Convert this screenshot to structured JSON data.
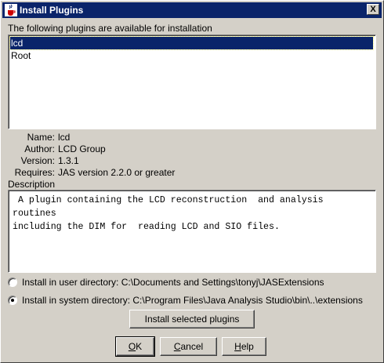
{
  "window": {
    "title": "Install Plugins",
    "close_symbol": "X"
  },
  "plugins_label": "The following plugins are available for installation",
  "plugins": [
    {
      "label": "lcd",
      "selected": true
    },
    {
      "label": "Root",
      "selected": false
    }
  ],
  "details": {
    "name_key": "Name:",
    "name_val": "lcd",
    "author_key": "Author:",
    "author_val": "LCD Group",
    "version_key": "Version:",
    "version_val": "1.3.1",
    "requires_key": "Requires:",
    "requires_val": "JAS version 2.2.0 or greater"
  },
  "description_label": "Description",
  "description_text": " A plugin containing the LCD reconstruction  and analysis routines\nincluding the DIM for  reading LCD and SIO files.",
  "install_options": {
    "user": {
      "label": "Install in user directory: C:\\Documents and Settings\\tonyj\\JASExtensions",
      "checked": false
    },
    "system": {
      "label": "Install in system directory: C:\\Program Files\\Java Analysis Studio\\bin\\..\\extensions",
      "checked": true
    }
  },
  "buttons": {
    "install_selected": "Install selected plugins",
    "ok_first": "O",
    "ok_rest": "K",
    "cancel_first": "C",
    "cancel_rest": "ancel",
    "help_first": "H",
    "help_rest": "elp"
  }
}
